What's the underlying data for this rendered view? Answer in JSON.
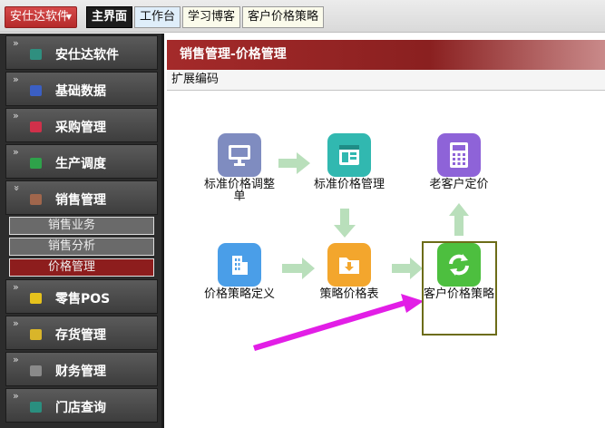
{
  "topbar": {
    "app_button": "安仕达软件",
    "tabs": [
      {
        "label": "主界面"
      },
      {
        "label": "工作台"
      },
      {
        "label": "学习博客"
      },
      {
        "label": "客户价格策略"
      }
    ]
  },
  "sidebar": {
    "items": [
      {
        "label": "安仕达软件",
        "icon_color": "#2f8f7f"
      },
      {
        "label": "基础数据",
        "icon_color": "#3b5fc4"
      },
      {
        "label": "采购管理",
        "icon_color": "#d0304a"
      },
      {
        "label": "生产调度",
        "icon_color": "#2ea24a"
      },
      {
        "label": "销售管理",
        "icon_color": "#a0664c"
      },
      {
        "label": "零售POS",
        "icon_color": "#e6c21c"
      },
      {
        "label": "存货管理",
        "icon_color": "#d9b52a"
      },
      {
        "label": "财务管理",
        "icon_color": "#8a8a8a"
      },
      {
        "label": "门店查询",
        "icon_color": "#2a8f7f"
      }
    ],
    "submenu": [
      {
        "label": "销售业务"
      },
      {
        "label": "销售分析"
      },
      {
        "label": "价格管理"
      }
    ]
  },
  "content": {
    "panel_title": "销售管理-价格管理",
    "toolbar_label": "扩展编码",
    "nodes": [
      {
        "label": "标准价格调整单",
        "icon": "monitor-icon",
        "color": "#7f8cc0"
      },
      {
        "label": "标准价格管理",
        "icon": "window-grid-icon",
        "color": "#31b8b0"
      },
      {
        "label": "老客户定价",
        "icon": "calculator-icon",
        "color": "#8e63d8"
      },
      {
        "label": "价格策略定义",
        "icon": "building-icon",
        "color": "#4a9ee8"
      },
      {
        "label": "策略价格表",
        "icon": "folder-download-icon",
        "color": "#f3a62d"
      },
      {
        "label": "客户价格策略",
        "icon": "refresh-icon",
        "color": "#4dbf3f"
      }
    ],
    "arrow_color": "#b9dfbb",
    "highlight_arrow_color": "#e21ee6"
  }
}
